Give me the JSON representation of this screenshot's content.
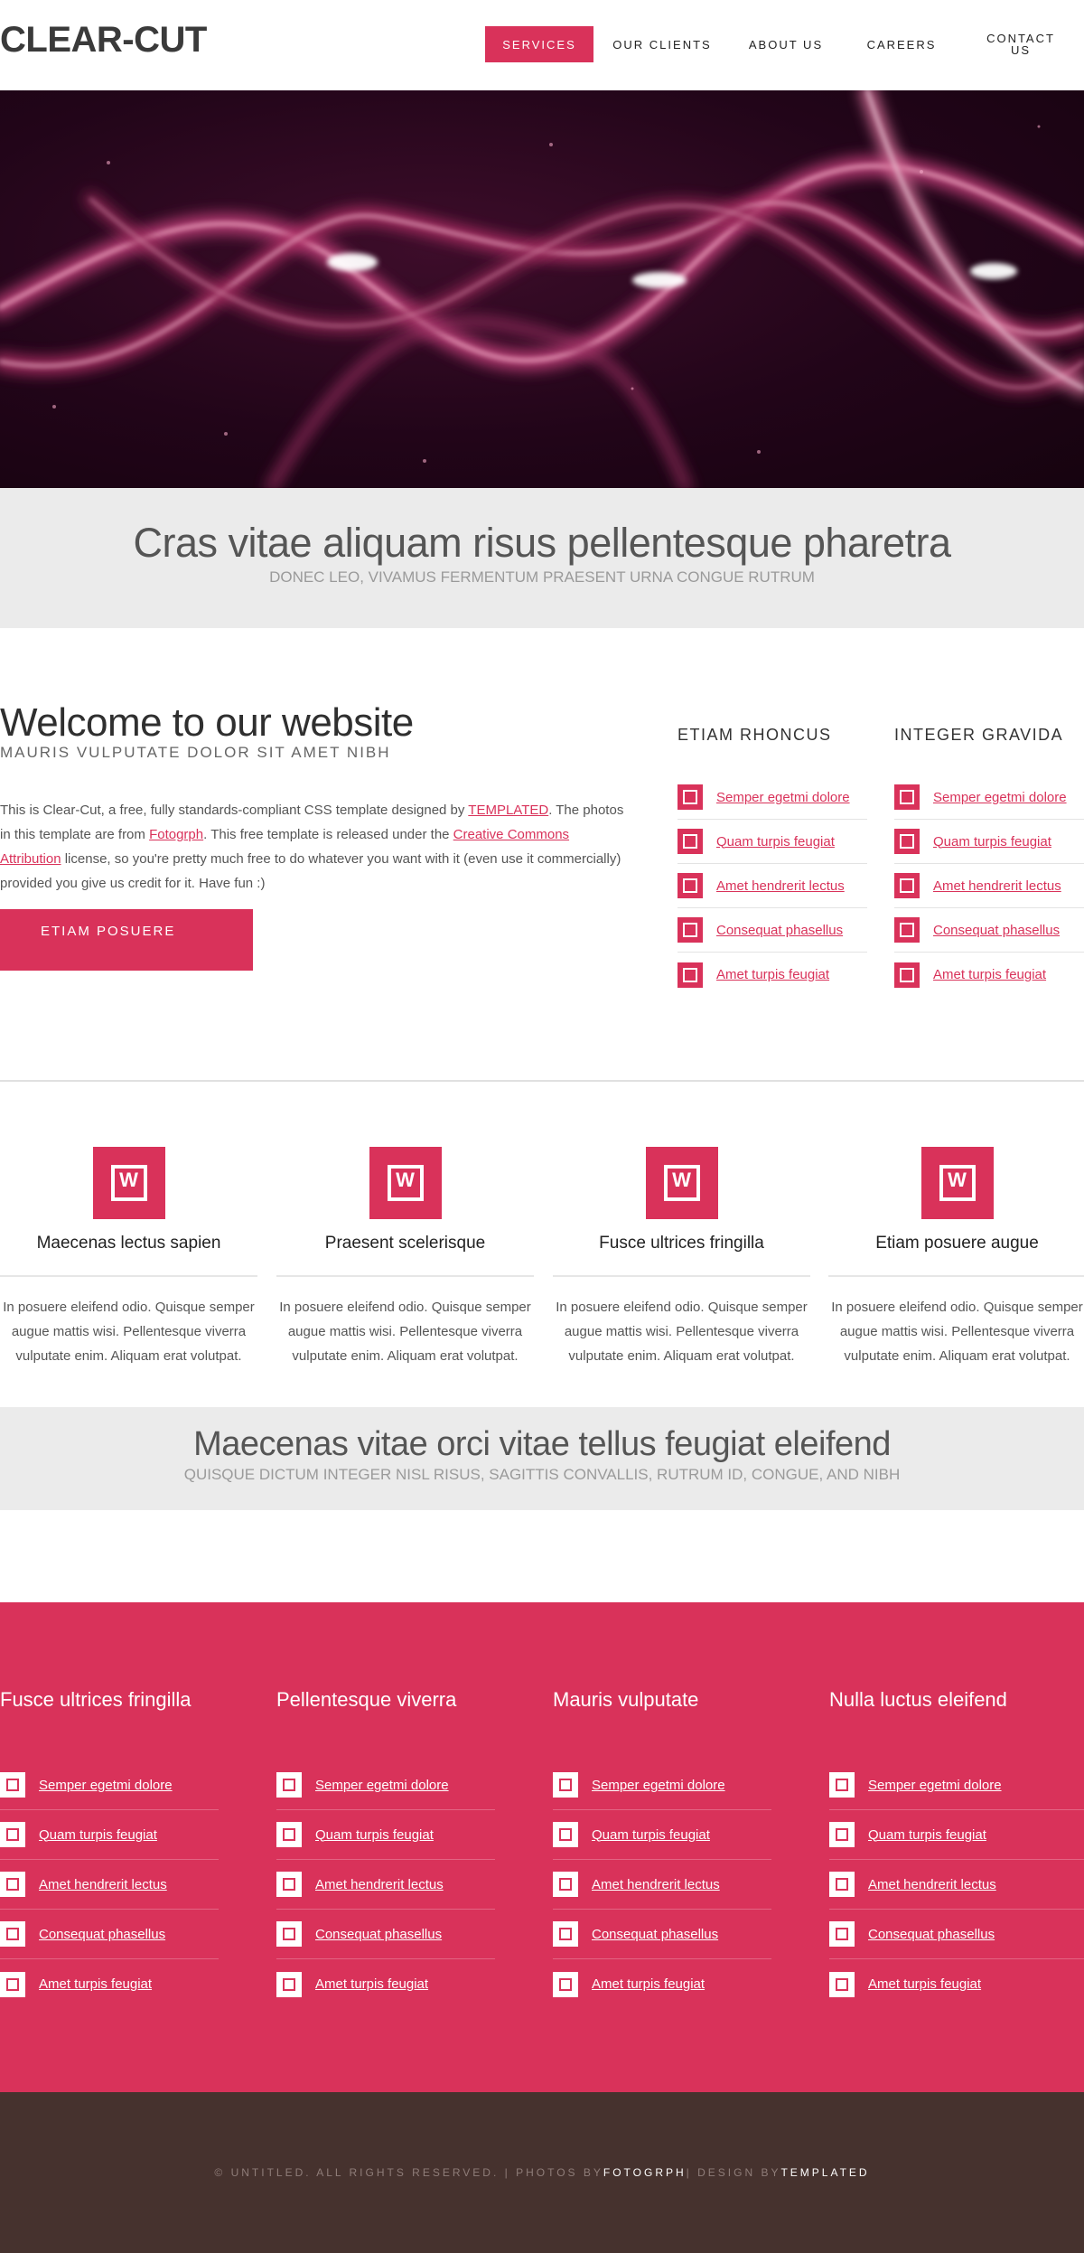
{
  "header": {
    "logo": "CLEAR-CUT",
    "nav": [
      {
        "label": "SERVICES",
        "active": true
      },
      {
        "label": "OUR CLIENTS",
        "active": false
      },
      {
        "label": "ABOUT US",
        "active": false
      },
      {
        "label": "CAREERS",
        "active": false
      },
      {
        "label": "CONTACT US",
        "active": false
      }
    ]
  },
  "intro_band": {
    "title": "Cras vitae aliquam risus pellentesque pharetra",
    "subtitle": "DONEC LEO, VIVAMUS FERMENTUM PRAESENT URNA CONGUE RUTRUM"
  },
  "welcome": {
    "title": "Welcome to our website",
    "subtitle": "MAURIS VULPUTATE DOLOR SIT AMET NIBH",
    "text_1": "This is Clear-Cut, a free, fully standards-compliant CSS template designed by ",
    "link_templated": "TEMPLATED",
    "text_2": ". The photos in this template are from ",
    "link_fotogrph": "Fotogrph",
    "text_3": ". This free template is released under the ",
    "link_cc": "Creative Commons Attribution",
    "text_4": " license, so you're pretty much free to do whatever you want with it (even use it commercially) provided you give us credit for it. Have fun :)",
    "cta_label": "ETIAM POSUERE"
  },
  "side_columns": [
    {
      "title": "ETIAM RHONCUS",
      "links": [
        "Semper egetmi dolore",
        "Quam turpis feugiat",
        "Amet hendrerit lectus",
        "Consequat phasellus",
        "Amet turpis feugiat"
      ]
    },
    {
      "title": "INTEGER GRAVIDA",
      "links": [
        "Semper egetmi dolore",
        "Quam turpis feugiat",
        "Amet hendrerit lectus",
        "Consequat phasellus",
        "Amet turpis feugiat"
      ]
    }
  ],
  "features": [
    {
      "title": "Maecenas lectus sapien",
      "text": "In posuere eleifend odio. Quisque semper augue mattis wisi. Pellentesque viverra vulputate enim. Aliquam erat volutpat."
    },
    {
      "title": "Praesent scelerisque",
      "text": "In posuere eleifend odio. Quisque semper augue mattis wisi. Pellentesque viverra vulputate enim. Aliquam erat volutpat."
    },
    {
      "title": "Fusce ultrices fringilla",
      "text": "In posuere eleifend odio. Quisque semper augue mattis wisi. Pellentesque viverra vulputate enim. Aliquam erat volutpat."
    },
    {
      "title": "Etiam posuere augue",
      "text": "In posuere eleifend odio. Quisque semper augue mattis wisi. Pellentesque viverra vulputate enim. Aliquam erat volutpat."
    }
  ],
  "second_band": {
    "title": "Maecenas vitae orci vitae tellus feugiat eleifend",
    "subtitle": "QUISQUE DICTUM INTEGER NISL RISUS, SAGITTIS CONVALLIS, RUTRUM ID, CONGUE, AND NIBH"
  },
  "red_columns": [
    {
      "title": "Fusce ultrices fringilla",
      "links": [
        "Semper egetmi dolore",
        "Quam turpis feugiat",
        "Amet hendrerit lectus",
        "Consequat phasellus",
        "Amet turpis feugiat"
      ]
    },
    {
      "title": "Pellentesque viverra",
      "links": [
        "Semper egetmi dolore",
        "Quam turpis feugiat",
        "Amet hendrerit lectus",
        "Consequat phasellus",
        "Amet turpis feugiat"
      ]
    },
    {
      "title": "Mauris vulputate",
      "links": [
        "Semper egetmi dolore",
        "Quam turpis feugiat",
        "Amet hendrerit lectus",
        "Consequat phasellus",
        "Amet turpis feugiat"
      ]
    },
    {
      "title": "Nulla luctus eleifend",
      "links": [
        "Semper egetmi dolore",
        "Quam turpis feugiat",
        "Amet hendrerit lectus",
        "Consequat phasellus",
        "Amet turpis feugiat"
      ]
    }
  ],
  "footer": {
    "copyright": "© UNTITLED. ALL RIGHTS RESERVED. | PHOTOS BY ",
    "photos_by": "FOTOGRPH",
    "design_prefix": " | DESIGN BY ",
    "design_by": "TEMPLATED"
  },
  "icons": {
    "link_icon": "box-icon",
    "feature_icon": "emblem-icon"
  },
  "colors": {
    "accent": "#d9325a",
    "footer_bg": "#46322e",
    "band_bg": "#ebebeb"
  }
}
